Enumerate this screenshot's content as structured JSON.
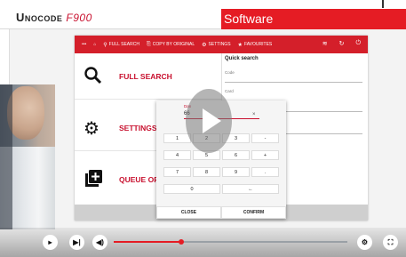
{
  "header": {
    "brand": "Unocode",
    "brand_model": "F900",
    "section_title": "Software"
  },
  "appbar": {
    "logo": "•••",
    "home_icon": "home-icon",
    "items": [
      {
        "icon": "search-icon",
        "glyph": "⚲",
        "label": "FULL SEARCH"
      },
      {
        "icon": "copy-icon",
        "glyph": "⎘",
        "label": "COPY BY ORIGINAL"
      },
      {
        "icon": "gear-icon",
        "glyph": "⚙",
        "label": "SETTINGS"
      },
      {
        "icon": "star-icon",
        "glyph": "★",
        "label": "FAVOURITES"
      }
    ],
    "right_icons": [
      "wifi-icon",
      "refresh-icon",
      "power-icon"
    ]
  },
  "menu": [
    {
      "icon": "search-icon",
      "glyph": "🔍︎",
      "label": "FULL SEARCH"
    },
    {
      "icon": "gear-icon",
      "glyph": "⚙",
      "label": "SETTINGS"
    },
    {
      "icon": "add-queue-icon",
      "glyph": "⊞",
      "label": "QUEUE OF"
    }
  ],
  "quick_search": {
    "title": "Quick search",
    "field_code": "Code",
    "field_card": "Card"
  },
  "keypad": {
    "label": "Dan",
    "value": "66",
    "clear": "×",
    "keys": [
      [
        "1",
        "2",
        "3",
        "-"
      ],
      [
        "4",
        "5",
        "6",
        "+"
      ],
      [
        "7",
        "8",
        "9",
        "."
      ],
      [
        "0",
        "←"
      ]
    ],
    "close_label": "CLOSE",
    "confirm_label": "CONFIRM"
  },
  "player": {
    "progress": 0.29,
    "colors": {
      "accent": "#e51c24",
      "brand_red": "#d41f2a"
    },
    "icons": [
      "next-icon",
      "volume-icon",
      "settings-icon",
      "fullscreen-icon"
    ]
  }
}
